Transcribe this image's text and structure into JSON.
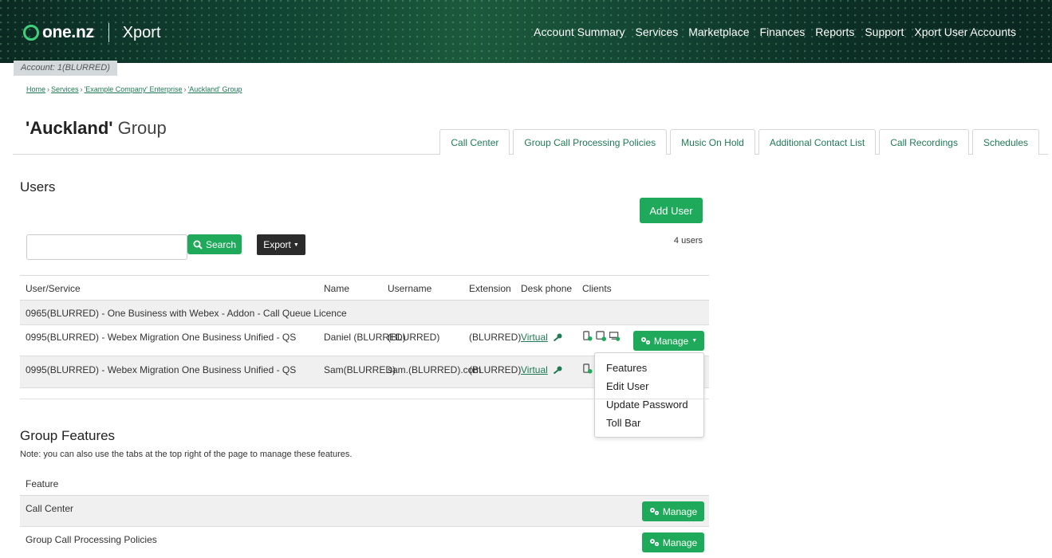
{
  "header": {
    "brand": "one.nz",
    "app": "Xport",
    "nav": [
      "Account Summary",
      "Services",
      "Marketplace",
      "Finances",
      "Reports",
      "Support",
      "Xport User Accounts"
    ]
  },
  "account": {
    "label": "Account: 1(BLURRED)"
  },
  "breadcrumb": [
    "Home",
    "Services",
    "'Example Company' Enterprise",
    "'Auckland' Group"
  ],
  "page": {
    "title_bold": "'Auckland'",
    "title_rest": "Group"
  },
  "tabs": [
    "Call Center",
    "Group Call Processing Policies",
    "Music On Hold",
    "Additional Contact List",
    "Call Recordings",
    "Schedules"
  ],
  "users": {
    "heading": "Users",
    "add_button": "Add User",
    "search_button": "Search",
    "search_placeholder": "",
    "export_button": "Export",
    "count": "4 users",
    "columns": [
      "User/Service",
      "Name",
      "Username",
      "Extension",
      "Desk phone",
      "Clients"
    ],
    "rows": [
      {
        "service": "0965(BLURRED) - One Business with Webex - Addon - Call Queue Licence"
      },
      {
        "service": "0995(BLURRED) - Webex Migration One Business Unified - QS",
        "name": "Daniel (BLURRED)",
        "username": "(BLURRED)",
        "extension": "(BLURRED)",
        "desk_phone": "Virtual",
        "manage": "Manage"
      },
      {
        "service": "0995(BLURRED) - Webex Migration One Business Unified - QS",
        "name": "Sam(BLURRED)",
        "username": "sam.(BLURRED).com",
        "extension": "(BLURRED)",
        "desk_phone": "Virtual"
      }
    ],
    "manage_menu": [
      "Features",
      "Edit User",
      "Update Password",
      "Toll Bar"
    ]
  },
  "group_features": {
    "heading": "Group Features",
    "note": "Note: you can also use the tabs at the top right of the page to manage these features.",
    "column": "Feature",
    "rows": [
      {
        "feature": "Call Center",
        "button": "Manage"
      },
      {
        "feature": "Group Call Processing Policies",
        "button": "Manage"
      }
    ]
  },
  "colors": {
    "brand_green": "#1eaa5a",
    "link_green": "#1f7a55",
    "header_dark": "#0b2a22"
  }
}
